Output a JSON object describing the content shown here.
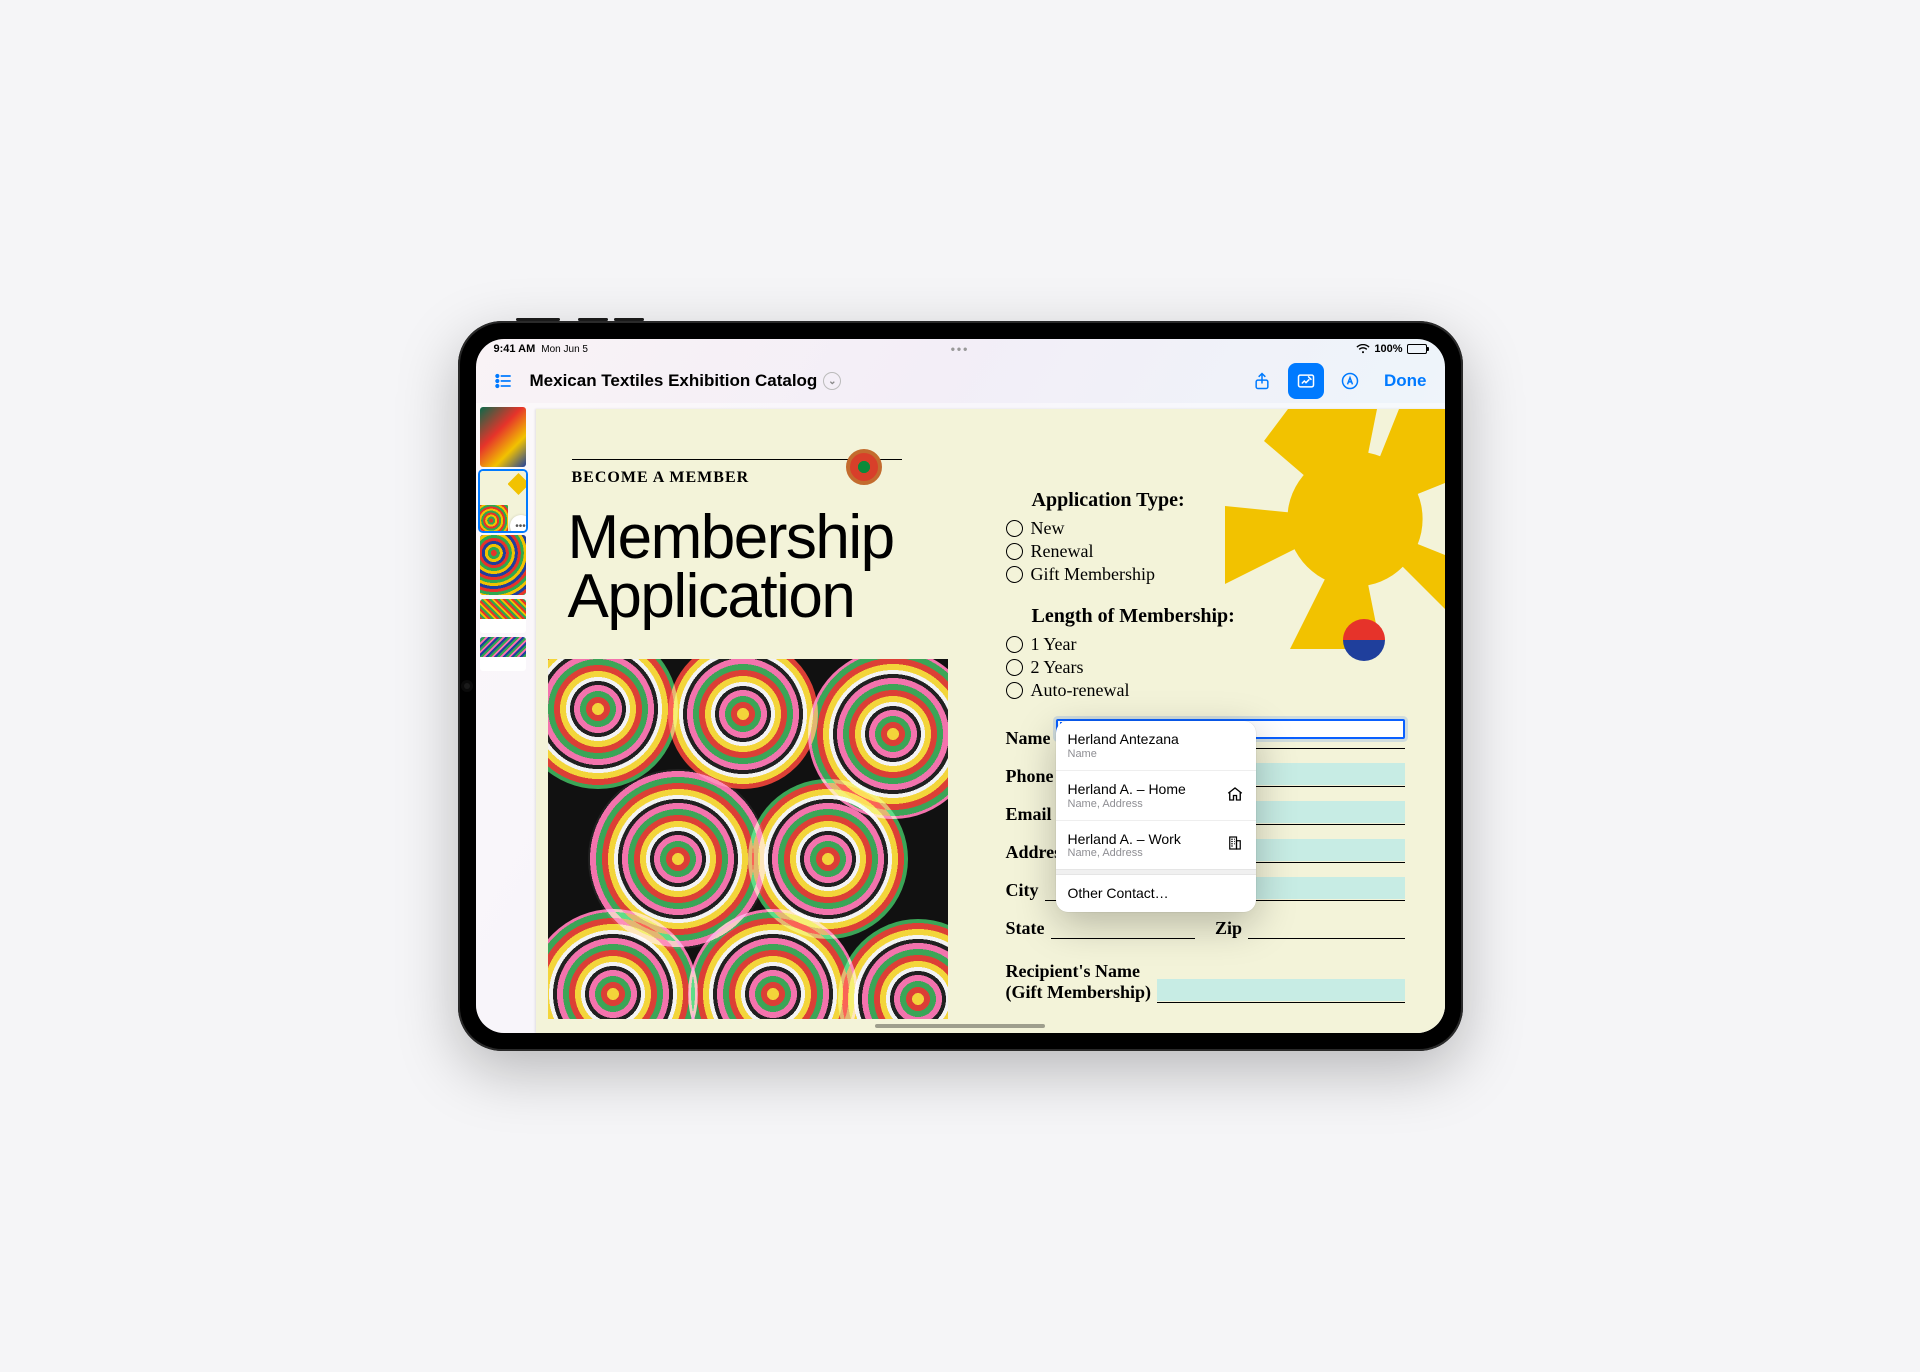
{
  "status": {
    "time": "9:41 AM",
    "date": "Mon Jun 5",
    "battery_pct": "100%"
  },
  "toolbar": {
    "doc_title": "Mexican Textiles Exhibition Catalog",
    "done_label": "Done"
  },
  "page": {
    "overline": "BECOME A MEMBER",
    "title_line1": "Membership",
    "title_line2": "Application"
  },
  "form": {
    "application_type": {
      "heading": "Application Type:",
      "options": [
        "New",
        "Renewal",
        "Gift Membership"
      ]
    },
    "length": {
      "heading": "Length of Membership:",
      "options": [
        "1 Year",
        "2 Years",
        "Auto-renewal"
      ]
    },
    "fields": {
      "name": "Name",
      "phone": "Phone",
      "email": "Email",
      "address": "Address",
      "city": "City",
      "state": "State",
      "zip": "Zip",
      "recipient_line1": "Recipient's Name",
      "recipient_line2": "(Gift Membership)"
    }
  },
  "autofill": {
    "items": [
      {
        "primary": "Herland Antezana",
        "secondary": "Name",
        "icon": "none"
      },
      {
        "primary": "Herland A. – Home",
        "secondary": "Name, Address",
        "icon": "home"
      },
      {
        "primary": "Herland A. – Work",
        "secondary": "Name, Address",
        "icon": "building"
      }
    ],
    "other": "Other Contact…"
  }
}
